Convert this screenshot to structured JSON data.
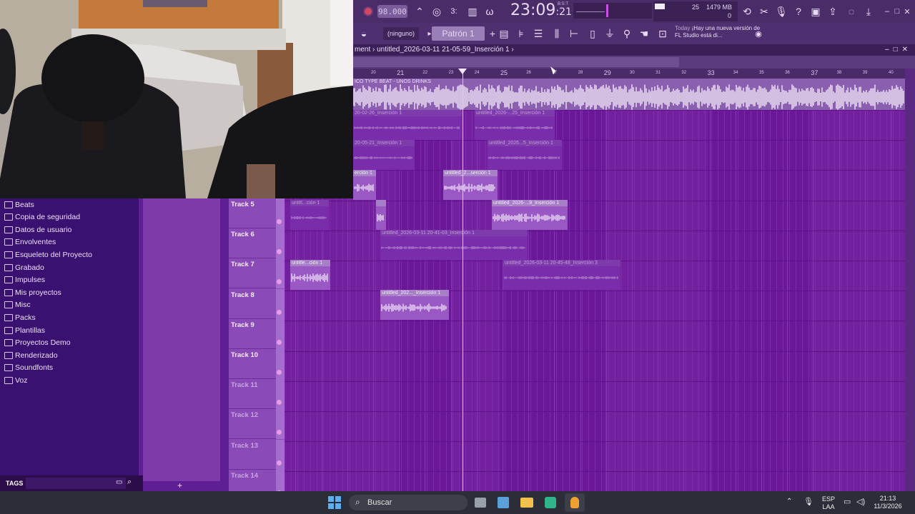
{
  "toolbar": {
    "tempo": "98.000",
    "pattern_label": "Patrón 1",
    "preset_label": "(ninguno)",
    "clock_main": "23:09",
    "clock_sec": ":21",
    "clock_unit": "B:S:T",
    "cpu_value": "25",
    "mem_value": "1479 MB",
    "voices_value": "0",
    "news_today": "Today",
    "news_text": "¡Hay una nueva versión de FL Studio está di..."
  },
  "playlist": {
    "breadcrumb": "ment › untitled_2026-03-11 21-05-59_Inserción 1 ›",
    "audio_track_label": "ICO TYPE BEAT - UNOS DRINKS",
    "ruler_major": [
      "21",
      "25",
      "29",
      "33",
      "37"
    ],
    "ruler_minor": [
      "20",
      "22",
      "23",
      "24",
      "26",
      "27",
      "28",
      "30",
      "31",
      "32",
      "34",
      "35",
      "36",
      "38",
      "39",
      "40"
    ]
  },
  "tracks": [
    {
      "name": "Track 5"
    },
    {
      "name": "Track 6"
    },
    {
      "name": "Track 7"
    },
    {
      "name": "Track 8"
    },
    {
      "name": "Track 9"
    },
    {
      "name": "Track 10"
    },
    {
      "name": "Track 11"
    },
    {
      "name": "Track 12"
    },
    {
      "name": "Track 13"
    },
    {
      "name": "Track 14"
    }
  ],
  "clips": {
    "c1": "20-02-26_Inserción 1",
    "c2": "untitled_2026-...25_Inserción 1",
    "c3": "20-05-21_Inserción 1",
    "c4": "untitled_2026...5_Inserción 1",
    "c5": "erción 1",
    "c6": "untitled_2...serción 1",
    "c7": "untitl...ción 1",
    "c8": "untitled_2026-...9_Inserción 1",
    "c9": "untitled_2026-03-11 20-41-03_Inserción 1",
    "c10": "untitle...ción 1",
    "c11": "untitled_2026-03-11 20-45-48_Inserción 3",
    "c12": "untitled_202..._Inserción 1"
  },
  "browser": {
    "items": [
      {
        "label": "Beats",
        "icon": "folder-icon"
      },
      {
        "label": "Copia de seguridad",
        "icon": "folder-icon"
      },
      {
        "label": "Datos de usuario",
        "icon": "user-icon"
      },
      {
        "label": "Envolventes",
        "icon": "folder-icon"
      },
      {
        "label": "Esqueleto del Proyecto",
        "icon": "folder-icon"
      },
      {
        "label": "Grabado",
        "icon": "folder-icon"
      },
      {
        "label": "Impulses",
        "icon": "folder-icon"
      },
      {
        "label": "Mis proyectos",
        "icon": "folder-icon"
      },
      {
        "label": "Misc",
        "icon": "folder-icon"
      },
      {
        "label": "Packs",
        "icon": "packs-icon"
      },
      {
        "label": "Plantillas",
        "icon": "folder-icon"
      },
      {
        "label": "Proyectos Demo",
        "icon": "folder-icon"
      },
      {
        "label": "Renderizado",
        "icon": "folder-icon"
      },
      {
        "label": "Soundfonts",
        "icon": "folder-icon"
      },
      {
        "label": "Voz",
        "icon": "folder-icon"
      }
    ],
    "tags_label": "TAGS",
    "add_label": "+"
  },
  "taskbar": {
    "search_placeholder": "Buscar",
    "lang_top": "ESP",
    "lang_bottom": "LAA",
    "time": "21:13",
    "date": "11/3/2026"
  },
  "colors": {
    "accent": "#7a2dab",
    "grid": "#72209e",
    "clip_active": "#9a58c4",
    "toolbar": "#4c2e6a"
  }
}
